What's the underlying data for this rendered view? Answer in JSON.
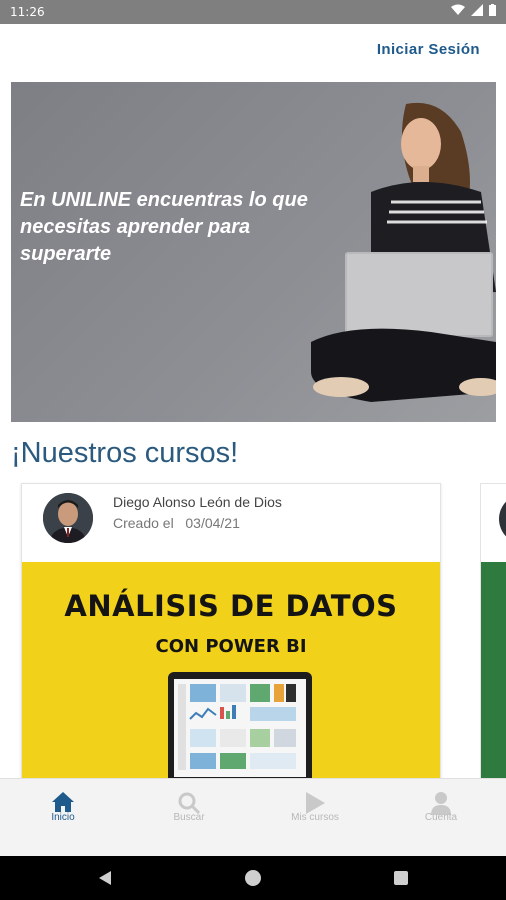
{
  "status_bar": {
    "time": "11:26"
  },
  "header": {
    "login_label": "Iniciar Sesión"
  },
  "hero": {
    "text": "En UNILINE encuentras lo que necesitas aprender para superarte"
  },
  "section": {
    "title": "¡Nuestros cursos!"
  },
  "courses": [
    {
      "author": "Diego Alonso León de Dios",
      "created_label": "Creado el",
      "created_date": "03/04/21",
      "title": "ANÁLISIS DE DATOS",
      "subtitle": "CON POWER BI"
    }
  ],
  "bottom_nav": [
    {
      "label": "Inicio",
      "icon": "home-icon"
    },
    {
      "label": "Buscar",
      "icon": "search-icon"
    },
    {
      "label": "Mis cursos",
      "icon": "play-icon"
    },
    {
      "label": "Cuenta",
      "icon": "person-icon"
    }
  ],
  "colors": {
    "accent": "#1e5a8c",
    "course_banner": "#f2d11a",
    "status_bar": "#7f7f7f"
  }
}
